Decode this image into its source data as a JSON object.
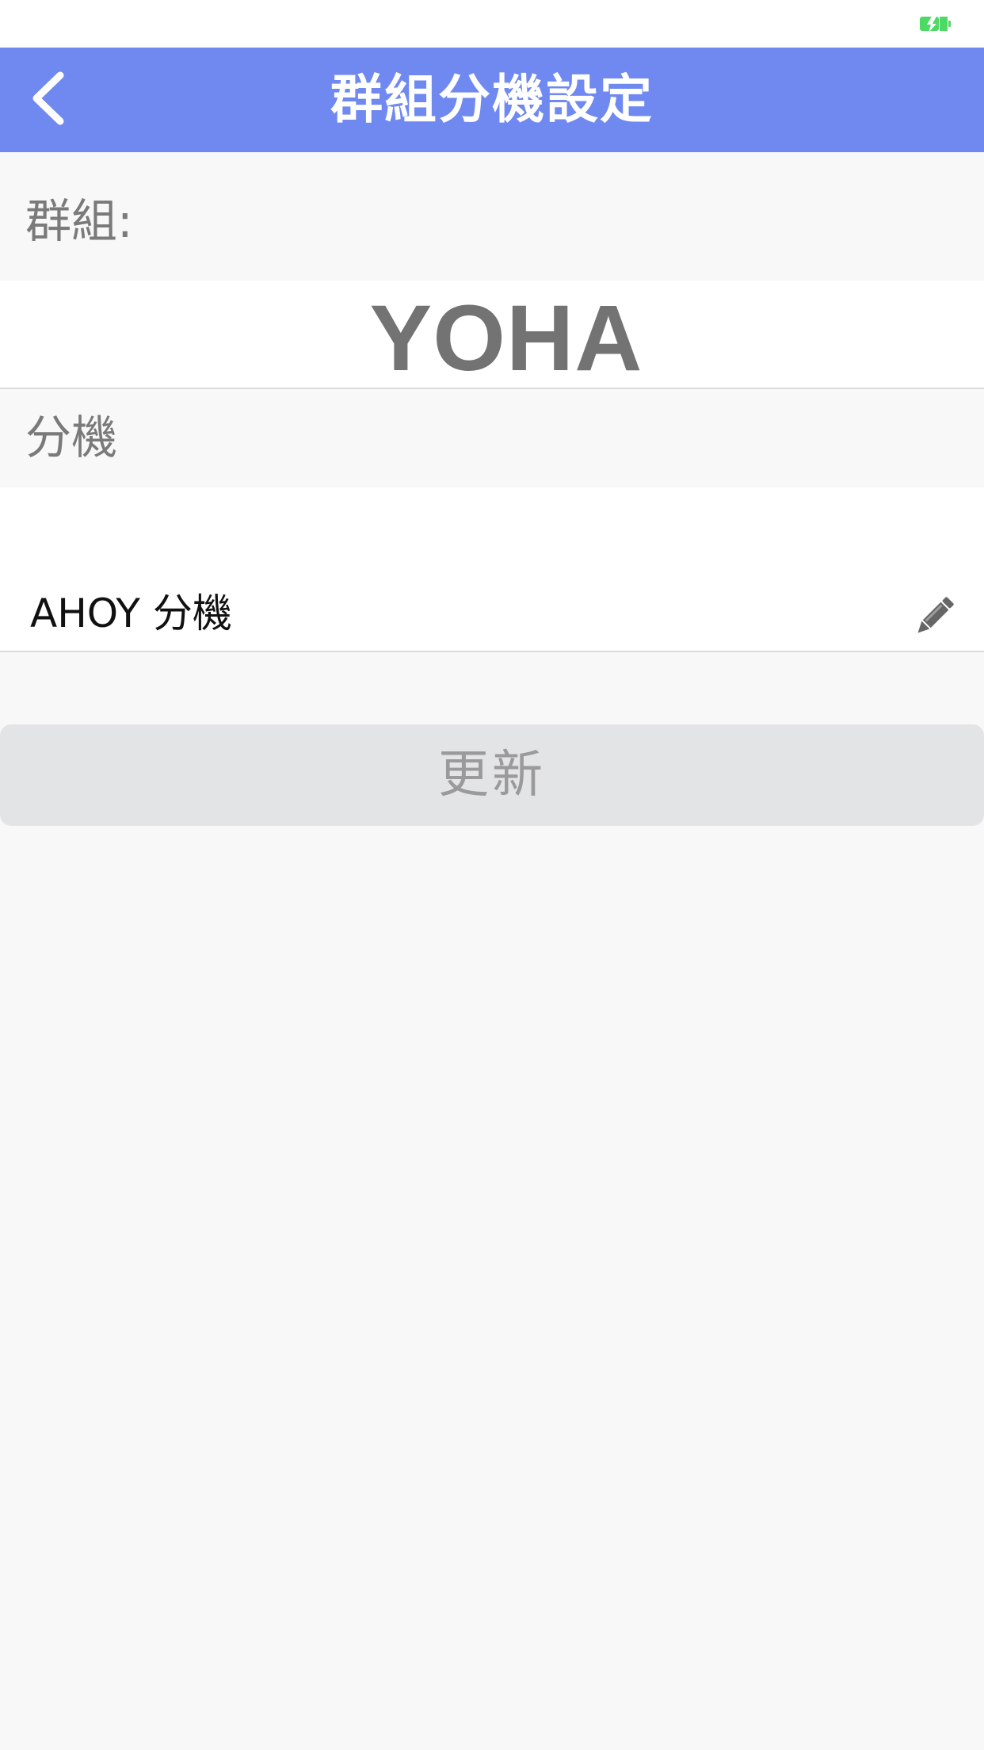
{
  "nav": {
    "title": "群組分機設定",
    "color": "#6f89f0"
  },
  "status_bar": {
    "battery_icon": "battery-charging-icon",
    "battery_color": "#4cd964"
  },
  "group": {
    "label": "群組:",
    "name": "YOHA"
  },
  "extension": {
    "label": "分機",
    "value": "AHOY 分機",
    "edit_icon": "pencil-icon"
  },
  "update_button": {
    "label": "更新"
  }
}
